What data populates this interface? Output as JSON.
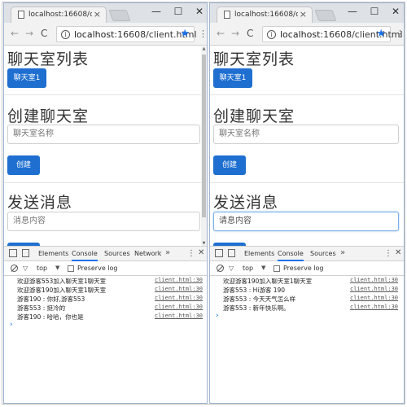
{
  "left": {
    "tab_title": "localhost:16608/client.html",
    "url_host": "localhost",
    "url_rest": ":16608/client.html",
    "section_rooms": "聊天室列表",
    "room_button": "聊天室1",
    "section_create": "创建聊天室",
    "room_name_placeholder": "聊天室名称",
    "create_button": "创建",
    "section_send": "发送消息",
    "message_placeholder": "消息内容",
    "devtools_tabs": [
      "Elements",
      "Console",
      "Sources",
      "Network"
    ],
    "context": "top",
    "preserve_log": "Preserve log",
    "logs": [
      {
        "msg": "欢迎游客553加入聊天室1聊天室",
        "src": "client.html:30"
      },
      {
        "msg": "欢迎游客190加入聊天室1聊天室",
        "src": "client.html:30"
      },
      {
        "msg": "游客190 : 你好,游客553",
        "src": "client.html:30"
      },
      {
        "msg": "游客553 : 挺冷的",
        "src": "client.html:30"
      },
      {
        "msg": "游客190 : 哈哈，你也是",
        "src": "client.html:30"
      }
    ]
  },
  "right": {
    "tab_title": "localhost:16608/client.html",
    "url_host": "localhost",
    "url_rest": ":16608/client.html",
    "section_rooms": "聊天室列表",
    "room_button": "聊天室1",
    "section_create": "创建聊天室",
    "room_name_placeholder": "聊天室名称",
    "create_button": "创建",
    "section_send": "发送消息",
    "message_placeholder": "请息内容",
    "devtools_tabs": [
      "Elements",
      "Console",
      "Sources"
    ],
    "context": "top",
    "preserve_log": "Preserve log",
    "logs": [
      {
        "msg": "欢迎游客190加入聊天室1聊天室",
        "src": "client.html:30"
      },
      {
        "msg": "游客553 : Hi游客 190",
        "src": "client.html:30"
      },
      {
        "msg": "游客553 : 今天天气怎么样",
        "src": "client.html:30"
      },
      {
        "msg": "游客553 : 新年快乐啊。",
        "src": "client.html:30"
      }
    ]
  },
  "window_controls": {
    "minimize": "—",
    "maximize": "☐",
    "close": "✕"
  },
  "icons": {
    "back": "arrow-left-icon",
    "forward": "arrow-right-icon",
    "reload": "reload-icon",
    "bookmark": "star-icon"
  },
  "colors": {
    "accent": "#1e6fd0",
    "link": "#1a73e8"
  }
}
